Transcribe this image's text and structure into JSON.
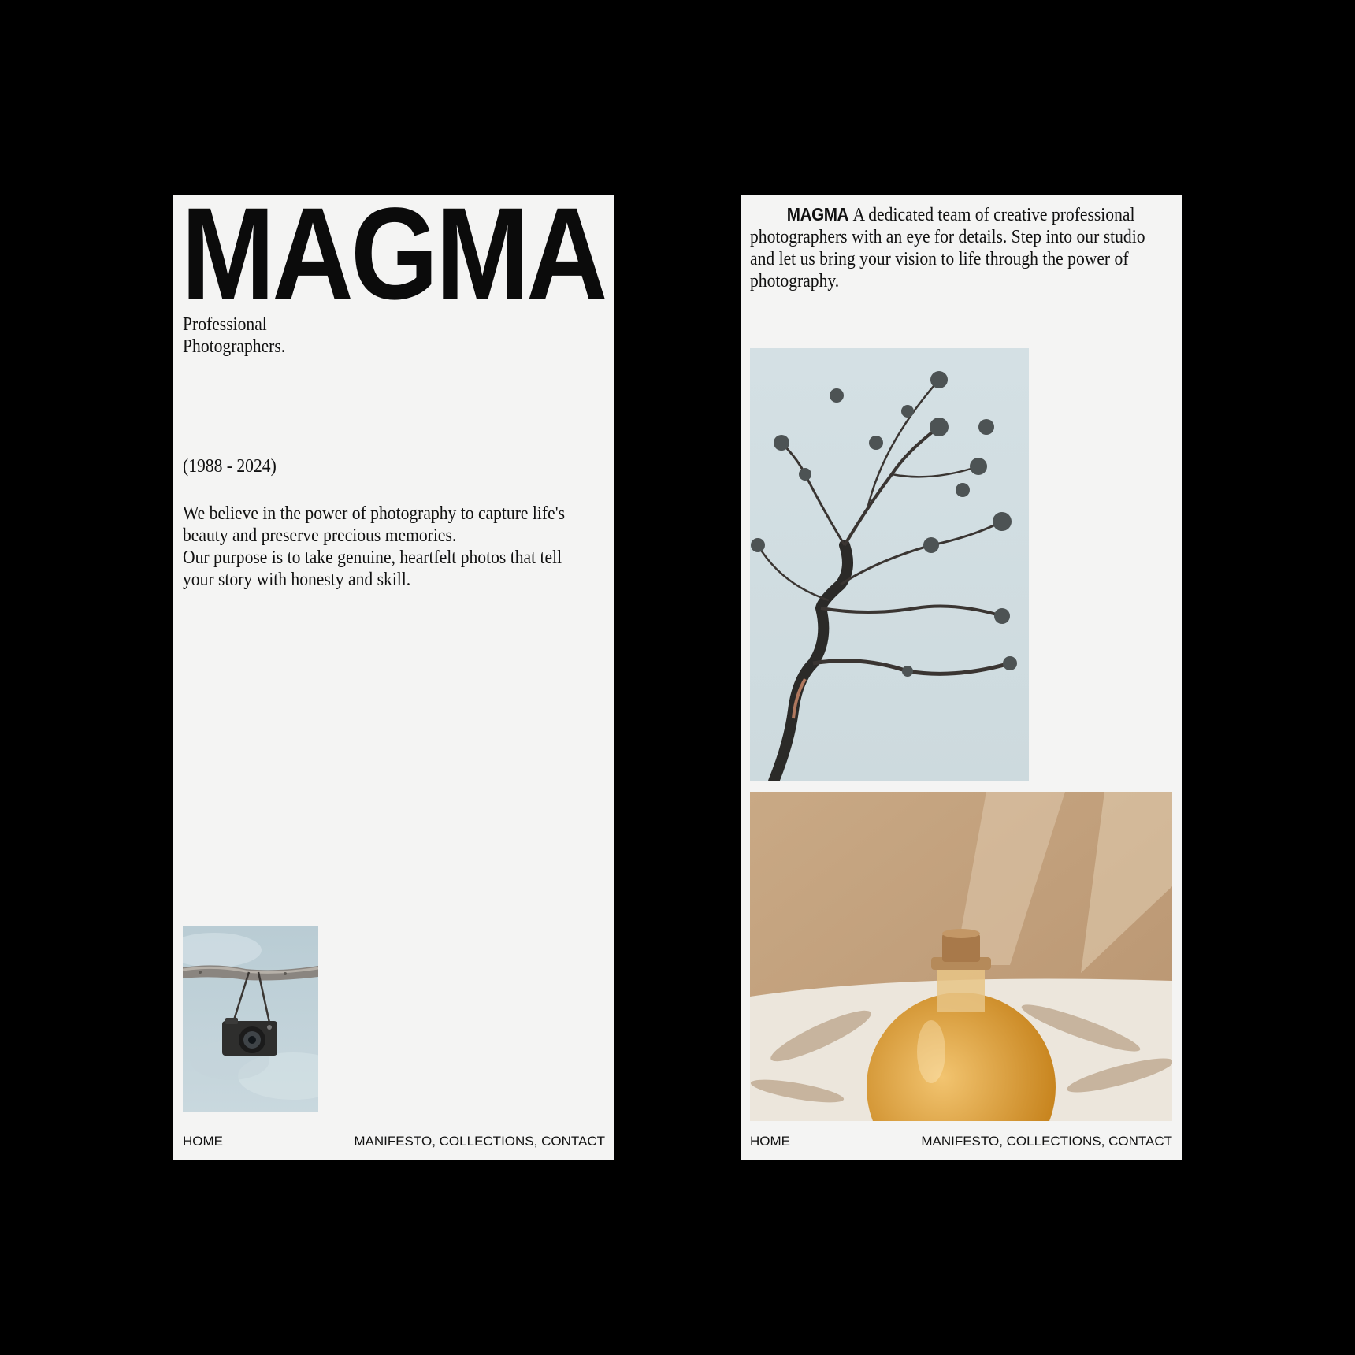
{
  "colors": {
    "backdrop": "#000000",
    "page": "#f4f4f3",
    "text": "#111111"
  },
  "left_screen": {
    "logo": "MAGMA",
    "tagline_line1": "Professional",
    "tagline_line2": "Photographers.",
    "years": "(1988 - 2024)",
    "mission_line1": "We believe in the power of photography to capture life's beauty and preserve precious memories.",
    "mission_line2": "Our purpose is to take genuine, heartfelt photos that tell your story with honesty and skill.",
    "image": "camera-hanging-from-branch-photo",
    "nav": {
      "home": "HOME",
      "manifesto": "MANIFESTO,",
      "collections": "COLLECTIONS,",
      "contact": "CONTACT"
    }
  },
  "right_screen": {
    "brand": "MAGMA",
    "intro": "A dedicated team of creative professional photographers with an eye for details. Step into our studio and let us bring your vision to life through the power of photography.",
    "images": [
      "pine-branch-photo",
      "amber-bottle-photo"
    ],
    "nav": {
      "home": "HOME",
      "manifesto": "MANIFESTO,",
      "collections": "COLLECTIONS,",
      "contact": "CONTACT"
    }
  }
}
